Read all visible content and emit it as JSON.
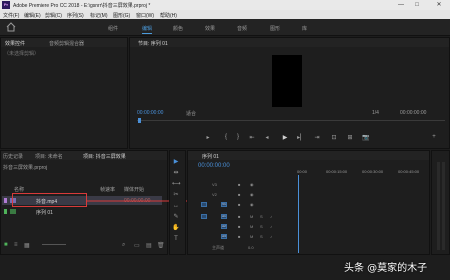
{
  "titlebar": {
    "title": "Adobe Premiere Pro CC 2018 - E:\\gsnrr\\抖音三屏效果.prproj *",
    "app_icon": "Pr",
    "minimize": "—",
    "maximize": "□",
    "close": "✕"
  },
  "menu": [
    "文件(F)",
    "编辑(E)",
    "剪辑(C)",
    "序列(S)",
    "标记(M)",
    "图形(G)",
    "窗口(W)",
    "帮助(H)"
  ],
  "workspaces": [
    "组件",
    "编辑",
    "颜色",
    "效果",
    "音频",
    "图形",
    "库"
  ],
  "source_panel": {
    "tabs": [
      "效果控件",
      "音频剪辑混合器"
    ],
    "placeholder": "（未选择剪辑）"
  },
  "program_monitor": {
    "tab": "节目: 序列 01",
    "timecode_left": "00:00:00:00",
    "fit": "适合",
    "zoom": "1/4",
    "timecode_right": "00:00:00:00",
    "controls": [
      "▸",
      "{",
      "}",
      "⇤",
      "◂",
      "▶",
      "▸▏",
      "⇥",
      "⊡",
      "⊞",
      "📷",
      "+"
    ]
  },
  "project_panel": {
    "tabs": [
      "历史记录",
      "项目: 未命名",
      "项目: 抖音三屏效果"
    ],
    "path": "抖音三屏效果.prproj",
    "headers": {
      "name": "名称",
      "frame_rate": "帧速率",
      "media_start": "媒体开始"
    },
    "items": [
      {
        "name": "抖音.mp4",
        "color": "#b17bd5",
        "selected": true
      },
      {
        "name": "序列 01",
        "color": "#4fb35a",
        "selected": false
      }
    ],
    "media_start_value": "00:00:00:00"
  },
  "tools": [
    "▶",
    "⇹",
    "⟷",
    "✂",
    "↔",
    "✎",
    "✋",
    "T"
  ],
  "timeline": {
    "tab": "序列 01",
    "timecode": "00:00:00:00",
    "ruler": [
      "00:00",
      "00:00:15:00",
      "00:00:30:00",
      "00:00:45:00"
    ],
    "video_tracks": [
      "V3",
      "V2",
      "V1"
    ],
    "audio_tracks": [
      "A1",
      "A2",
      "A3"
    ],
    "master": "主声道",
    "master_value": "0.0"
  },
  "watermark": "头条 @莫家的木子"
}
